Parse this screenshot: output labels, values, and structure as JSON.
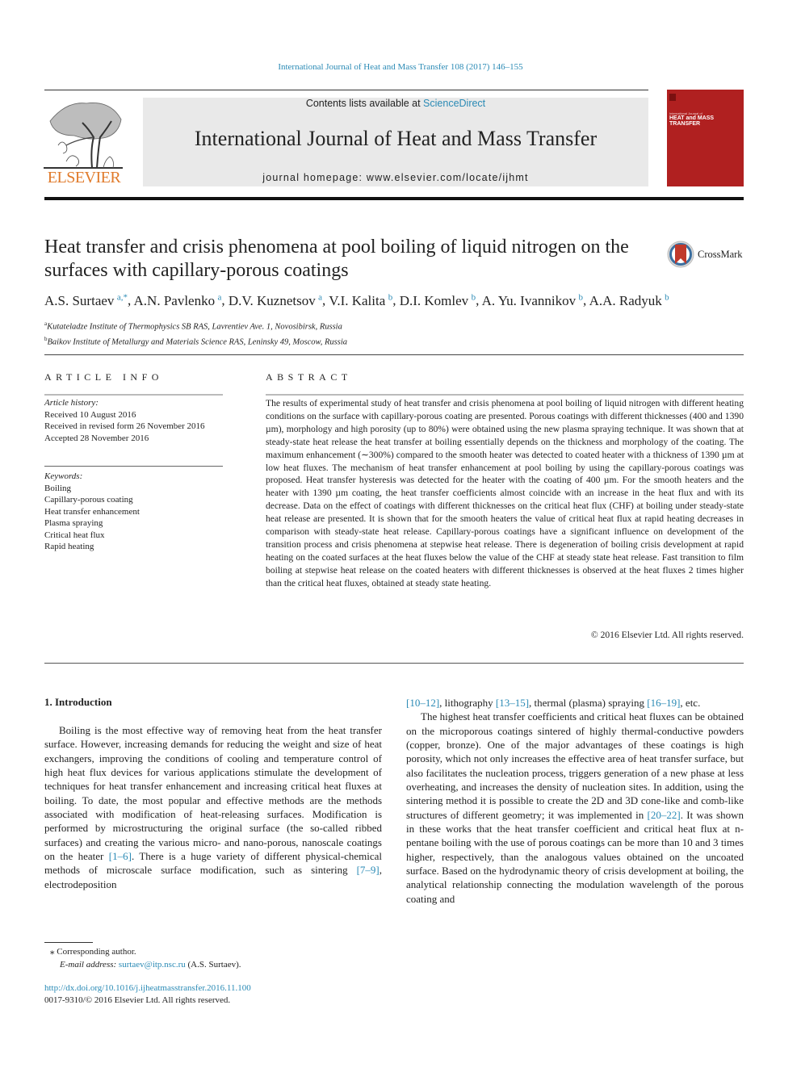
{
  "running_head": "International Journal of Heat and Mass Transfer 108 (2017) 146–155",
  "masthead": {
    "contents_prefix": "Contents lists available at ",
    "contents_link": "ScienceDirect",
    "journal_title": "International Journal of Heat and Mass Transfer",
    "homepage": "journal homepage: www.elsevier.com/locate/ijhmt",
    "publisher_logo_text": "ELSEVIER",
    "cover": {
      "small_text": "International Journal of",
      "title_line1": "HEAT and MASS",
      "title_line2": "TRANSFER",
      "color": "#b02020"
    }
  },
  "article": {
    "title": "Heat transfer and crisis phenomena at pool boiling of liquid nitrogen on the surfaces with capillary-porous coatings",
    "crossmark_label": "CrossMark",
    "authors": [
      {
        "name": "A.S. Surtaev",
        "sup": "a,*"
      },
      {
        "name": "A.N. Pavlenko",
        "sup": "a"
      },
      {
        "name": "D.V. Kuznetsov",
        "sup": "a"
      },
      {
        "name": "V.I. Kalita",
        "sup": "b"
      },
      {
        "name": "D.I. Komlev",
        "sup": "b"
      },
      {
        "name": "A. Yu. Ivannikov",
        "sup": "b"
      },
      {
        "name": "A.A. Radyuk",
        "sup": "b"
      }
    ],
    "affiliations": [
      {
        "mark": "a",
        "text": "Kutateladze Institute of Thermophysics SB RAS, Lavrentiev Ave. 1, Novosibirsk, Russia"
      },
      {
        "mark": "b",
        "text": "Baikov Institute of Metallurgy and Materials Science RAS, Leninsky 49, Moscow, Russia"
      }
    ]
  },
  "article_info": {
    "heading": "ARTICLE INFO",
    "history_label": "Article history:",
    "history": [
      "Received 10 August 2016",
      "Received in revised form 26 November 2016",
      "Accepted 28 November 2016"
    ],
    "keywords_label": "Keywords:",
    "keywords": [
      "Boiling",
      "Capillary-porous coating",
      "Heat transfer enhancement",
      "Plasma spraying",
      "Critical heat flux",
      "Rapid heating"
    ]
  },
  "abstract": {
    "heading": "ABSTRACT",
    "text": "The results of experimental study of heat transfer and crisis phenomena at pool boiling of liquid nitrogen with different heating conditions on the surface with capillary-porous coating are presented. Porous coat­ings with different thicknesses (400 and 1390 µm), morphology and high porosity (up to 80%) were obtained using the new plasma spraying technique. It was shown that at steady-state heat release the heat transfer at boiling essentially depends on the thickness and morphology of the coating. The maxi­mum enhancement (∼300%) compared to the smooth heater was detected to coated heater with a thick­ness of 1390 µm at low heat fluxes. The mechanism of heat transfer enhancement at pool boiling by using the capillary-porous coatings was proposed. Heat transfer hysteresis was detected for the heater with the coating of 400 µm. For the smooth heaters and the heater with 1390 µm coating, the heat transfer coef­ficients almost coincide with an increase in the heat flux and with its decrease. Data on the effect of coat­ings with different thicknesses on the critical heat flux (CHF) at boiling under steady-state heat release are presented. It is shown that for the smooth heaters the value of critical heat flux at rapid heating decreases in comparison with steady-state heat release. Capillary-porous coatings have a significant influence on development of the transition process and crisis phenomena at stepwise heat release. There is degeneration of boiling crisis development at rapid heating on the coated surfaces at the heat fluxes below the value of the CHF at steady state heat release. Fast transition to film boiling at stepwise heat release on the coated heaters with different thicknesses is observed at the heat fluxes 2 times higher than the critical heat fluxes, obtained at steady state heating.",
    "copyright": "© 2016 Elsevier Ltd. All rights reserved."
  },
  "body": {
    "section_heading": "1. Introduction",
    "left_para": {
      "t1": "Boiling is the most effective way of removing heat from the heat transfer surface. However, increasing demands for reducing the weight and size of heat exchangers, improving the conditions of cooling and temperature control of high heat flux devices for var­ious applications stimulate the development of techniques for heat transfer enhancement and increasing critical heat fluxes at boiling. To date, the most popular and effective methods are the methods associated with modification of heat-releasing surfaces. Modifica­tion is performed by microstructuring the original surface (the so-called ribbed surfaces) and creating the various micro- and nano-porous, nanoscale coatings on the heater ",
      "ref1": "[1–6]",
      "t2": ". There is a huge variety of different physical-chemical methods of microscale surface modification, such as sintering ",
      "ref2": "[7–9]",
      "t3": ", electrodeposition"
    },
    "right_para1": {
      "ref1": "[10–12]",
      "t1": ", lithography ",
      "ref2": "[13–15]",
      "t2": ", thermal (plasma) spraying ",
      "ref3": "[16–19]",
      "t3": ", etc."
    },
    "right_para2": {
      "t1": "The highest heat transfer coefficients and critical heat fluxes can be obtained on the microporous coatings sintered of highly thermal-conductive powders (copper, bronze). One of the major advantages of these coatings is high porosity, which not only increases the effective area of heat transfer surface, but also facil­itates the nucleation process, triggers generation of a new phase at less overheating, and increases the density of nucleation sites. In addition, using the sintering method it is possible to create the 2D and 3D cone-like and comb-like structures of different geome­try; it was implemented in ",
      "ref1": "[20–22]",
      "t2": ". It was shown in these works that the heat transfer coefficient and critical heat flux at n-pentane boiling with the use of porous coatings can be more than 10 and 3 times higher, respectively, than the analogous values obtained on the uncoated surface. Based on the hydrodynamic the­ory of crisis development at boiling, the analytical relationship connecting the modulation wavelength of the porous coating and"
    }
  },
  "footnote": {
    "star": "⁎",
    "corresponding": "Corresponding author.",
    "email_label": "E-mail address:",
    "email": "surtaev@itp.nsc.ru",
    "email_suffix": " (A.S. Surtaev)."
  },
  "doi": {
    "url": "http://dx.doi.org/10.1016/j.ijheatmasstransfer.2016.11.100",
    "issn_line": "0017-9310/© 2016 Elsevier Ltd. All rights reserved."
  },
  "colors": {
    "link": "#2a8ab5",
    "elsevier_orange": "#e07a2a",
    "cover_red": "#b02020",
    "masthead_gray": "#e9e9e9"
  }
}
